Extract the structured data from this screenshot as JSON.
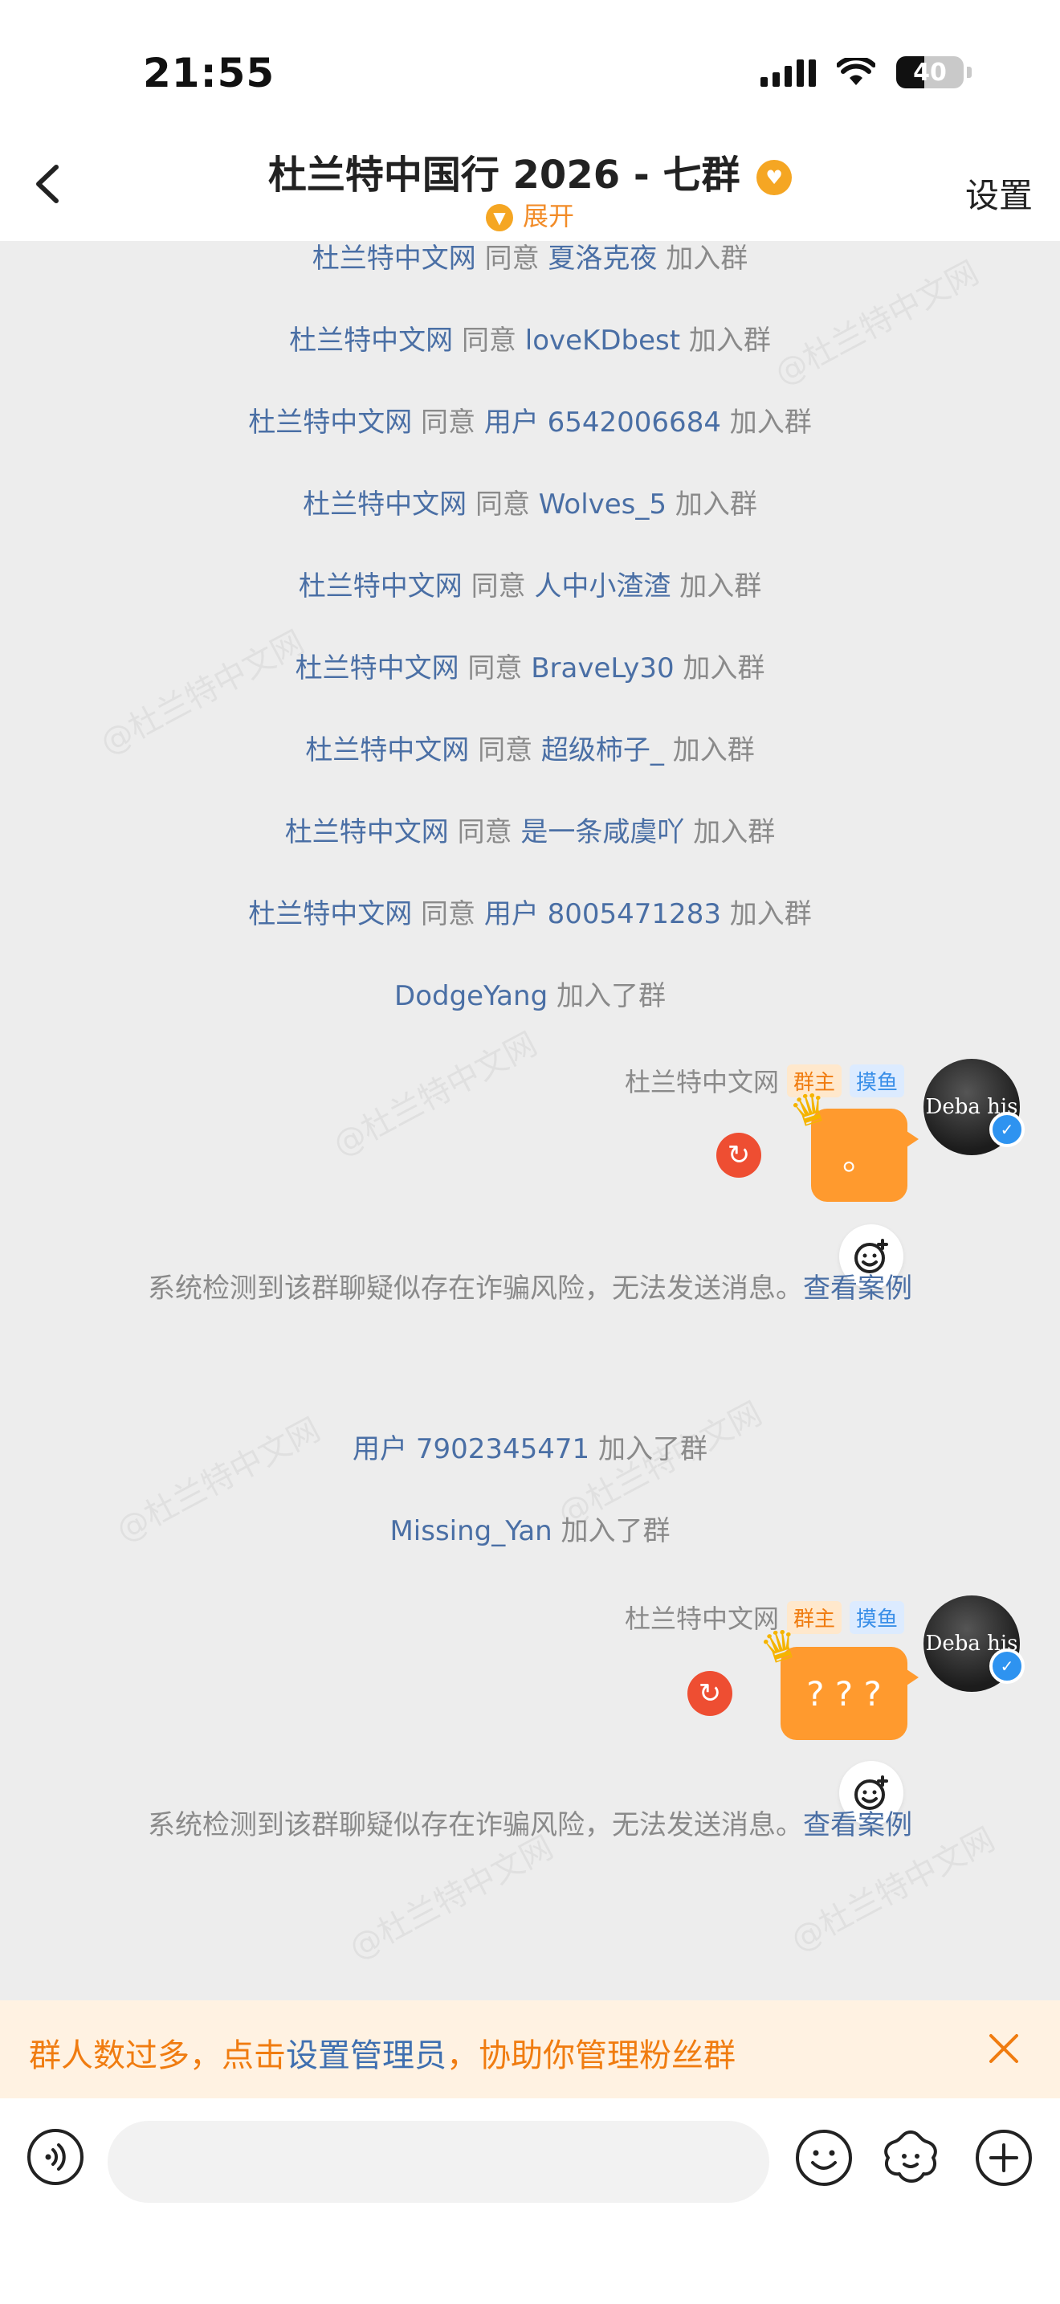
{
  "status": {
    "time": "21:55",
    "battery": "40"
  },
  "header": {
    "title": "杜兰特中国行 2026 - 七群",
    "expand": "展开",
    "settings": "设置"
  },
  "watermark": "@杜兰特中文网",
  "joins": [
    {
      "actor": "杜兰特中文网",
      "verb": "同意",
      "user": "夏洛克夜",
      "suffix": "加入群"
    },
    {
      "actor": "杜兰特中文网",
      "verb": "同意",
      "user": "loveKDbest",
      "suffix": "加入群"
    },
    {
      "actor": "杜兰特中文网",
      "verb": "同意",
      "user": "用户 6542006684",
      "suffix": "加入群"
    },
    {
      "actor": "杜兰特中文网",
      "verb": "同意",
      "user": "Wolves_5",
      "suffix": "加入群"
    },
    {
      "actor": "杜兰特中文网",
      "verb": "同意",
      "user": "人中小渣渣",
      "suffix": "加入群"
    },
    {
      "actor": "杜兰特中文网",
      "verb": "同意",
      "user": "BraveLy30",
      "suffix": "加入群"
    },
    {
      "actor": "杜兰特中文网",
      "verb": "同意",
      "user": "超级柿子_",
      "suffix": "加入群"
    },
    {
      "actor": "杜兰特中文网",
      "verb": "同意",
      "user": "是一条咸虞吖",
      "suffix": "加入群"
    },
    {
      "actor": "杜兰特中文网",
      "verb": "同意",
      "user": "用户 8005471283",
      "suffix": "加入群"
    }
  ],
  "joined": [
    {
      "user": "DodgeYang",
      "suffix": "加入了群"
    },
    {
      "user": "用户 7902345471",
      "suffix": "加入了群"
    },
    {
      "user": "Missing_Yan",
      "suffix": "加入了群"
    }
  ],
  "messages": [
    {
      "sender": "杜兰特中文网",
      "badge_owner": "群主",
      "badge_tag": "摸鱼",
      "avatar_text": "Deba  his",
      "text": "。"
    },
    {
      "sender": "杜兰特中文网",
      "badge_owner": "群主",
      "badge_tag": "摸鱼",
      "avatar_text": "Deba  his",
      "text": "? ? ?"
    }
  ],
  "warning": {
    "text": "系统检测到该群聊疑似存在诈骗风险，无法发送消息。",
    "link": "查看案例"
  },
  "banner": {
    "part1": "群人数过多，点击",
    "link": "设置管理员",
    "part2": "，协助你管理粉丝群"
  },
  "input": {
    "placeholder": ""
  },
  "icons": {
    "back": "chevron-left-icon",
    "vip": "vip-icon",
    "expand": "chevron-down-icon",
    "retry": "retry-icon",
    "react": "emoji-add-icon",
    "close": "close-icon",
    "voice": "voice-icon",
    "emoji": "emoji-icon",
    "sticker": "sticker-icon",
    "plus": "plus-icon"
  },
  "colors": {
    "accent": "#FF9A2E",
    "link": "#4A6FA5",
    "banner_text": "#F07C10",
    "error": "#EE4E32"
  }
}
